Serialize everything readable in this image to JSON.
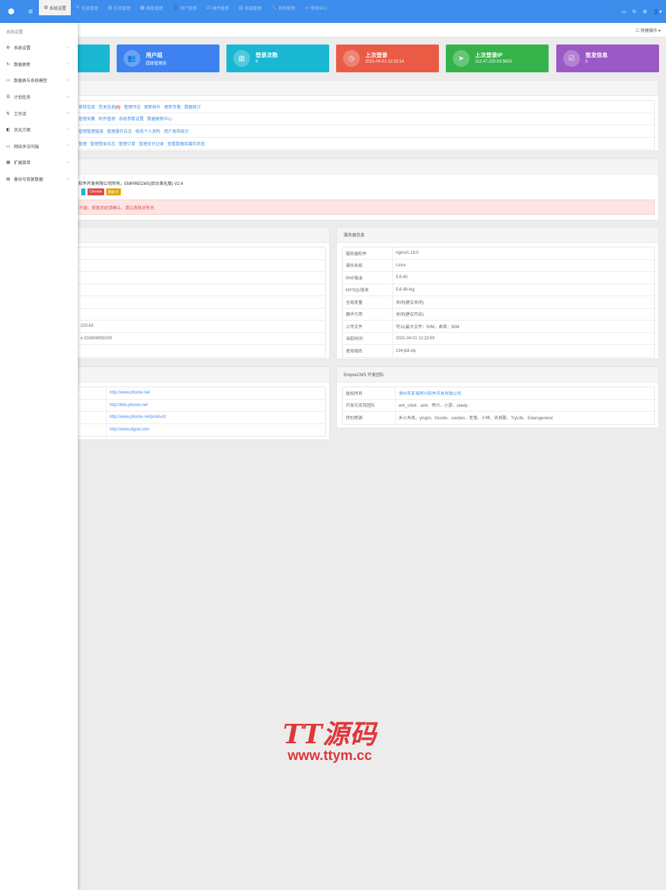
{
  "topnav": {
    "tabs": [
      {
        "icon": "⚙",
        "label": "系统设置",
        "active": true
      },
      {
        "icon": "✎",
        "label": "信息管理",
        "active": false
      },
      {
        "icon": "▤",
        "label": "栏目管理",
        "active": false
      },
      {
        "icon": "▦",
        "label": "模板管理",
        "active": false
      },
      {
        "icon": "👤",
        "label": "用户管理",
        "active": false
      },
      {
        "icon": "☑",
        "label": "插件管理",
        "active": false
      },
      {
        "icon": "▥",
        "label": "商城管理",
        "active": false
      },
      {
        "icon": "🔧",
        "label": "其他管理",
        "active": false
      },
      {
        "icon": "▭",
        "label": "帮助中心",
        "active": false
      }
    ]
  },
  "sidebar": {
    "title": "系统设置",
    "items": [
      {
        "icon": "⚙",
        "label": "系统设置"
      },
      {
        "icon": "↻",
        "label": "数据更新"
      },
      {
        "icon": "▭",
        "label": "数据表与系统模型"
      },
      {
        "icon": "☰",
        "label": "计划任务"
      },
      {
        "icon": "⇅",
        "label": "工作流"
      },
      {
        "icon": "◧",
        "label": "优化方案"
      },
      {
        "icon": "▭",
        "label": "网站多访问端"
      },
      {
        "icon": "▦",
        "label": "扩展菜单"
      },
      {
        "icon": "▤",
        "label": "备份与恢复数据"
      }
    ]
  },
  "subheader": {
    "quick": "☐ 快捷操作 ▾"
  },
  "cards": [
    {
      "icon": "👥",
      "title": "用户组",
      "value": "超级管理员",
      "color": "#3d82f0"
    },
    {
      "icon": "▥",
      "title": "登录次数",
      "value": "6",
      "color": "#1ab7d3"
    },
    {
      "icon": "◷",
      "title": "上次登录",
      "value": "2021-04-01 12:22:14",
      "color": "#ea5b46"
    },
    {
      "icon": "➤",
      "title": "上次登录IP",
      "value": "112.47.220.63:5633",
      "color": "#35b34a"
    },
    {
      "icon": "☑",
      "title": "签发信息",
      "value": "0",
      "color": "#9b59c6"
    }
  ],
  "shortcuts": {
    "rows": [
      [
        "审核信息",
        "签发信息",
        "管理评论",
        "更新碎片",
        "更新专题",
        "数据统计"
      ],
      [
        "管理采集",
        "附件管理",
        "系统参数设置",
        "数据更新中心"
      ],
      [
        "管理管理链接",
        "管理操作日志",
        "修改个人资料",
        "用户发布统计"
      ],
      [
        "管理",
        "管理登录日志",
        "管理订单",
        "管理支付记录",
        "查看数据库缓存状态"
      ]
    ],
    "badge": "(0)"
  },
  "official": {
    "text": "软件开发有限公司所有。EMPIRECMS(后台美化版) V2.4",
    "badges": [
      {
        "label": "Chrome",
        "color": "#e0494a"
      },
      {
        "label": "模板式",
        "color": "#e0a400"
      }
    ],
    "alert": "升级、修复后经请确认、请认真核对有关"
  },
  "version": {
    "rows": [
      "",
      "",
      "",
      "",
      "",
      "",
      "220.63",
      "e 201804091030",
      ""
    ]
  },
  "server": {
    "title": "服务器信息",
    "rows": [
      {
        "k": "服务器软件",
        "v": "nginx/1.18.0"
      },
      {
        "k": "操作系统",
        "v": "Linux"
      },
      {
        "k": "PHP版本",
        "v": "5.6.40"
      },
      {
        "k": "MYSQL版本",
        "v": "5.6.48-log"
      },
      {
        "k": "全局变量",
        "v": "关闭(建议关闭)"
      },
      {
        "k": "魔术引用",
        "v": "关闭(建议开启)"
      },
      {
        "k": "上传文件",
        "v": "可以(最大文件：50M，表单：50M"
      },
      {
        "k": "当前时间",
        "v": "2021-04-01 12:23:59"
      },
      {
        "k": "使用域名",
        "v": "134.jtdl.vip"
      }
    ]
  },
  "links": {
    "rows": [
      {
        "v": "http://www.phome.net"
      },
      {
        "v": "http://bbs.phome.net"
      },
      {
        "v": "http://www.phome.net/product/"
      },
      {
        "v": "http://www.digod.com"
      }
    ]
  },
  "team": {
    "title": "EmpireCMS 开发团队",
    "rows": [
      {
        "k": "版权所有",
        "v": "漳州市芗城帝兴软件开发有限公司",
        "link": true
      },
      {
        "k": "开发与支持团队",
        "v": "wm_chief、amt、帝兴、小游、zeedy",
        "link": false
      },
      {
        "k": "特别感谢",
        "v": "禾火木风、yingnt、hicode、sooden、老鬼、小林、天浪歌、TryLife、5starsgeneral",
        "link": false
      }
    ]
  },
  "watermark": {
    "line1": "TT源码",
    "line2": "www.ttym.cc"
  }
}
